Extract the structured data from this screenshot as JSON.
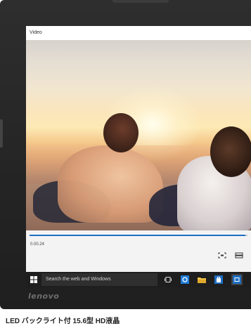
{
  "window": {
    "title": "Video"
  },
  "player": {
    "time": "0.00.24",
    "progress": 0.99
  },
  "controls": {
    "fullscreen_icon": "fullscreen-icon",
    "aspect_icon": "aspect-ratio-icon"
  },
  "taskbar": {
    "search_text": "Search the web and Windows",
    "start_icon": "windows-logo-icon",
    "icons": [
      "task-view-icon",
      "edge-browser-icon",
      "file-explorer-icon",
      "store-icon",
      "settings-app-icon"
    ],
    "accent_color": "#1f6fc4"
  },
  "device": {
    "brand": "lenovo"
  },
  "caption": "LED バックライト付 15.6型 HD液晶"
}
